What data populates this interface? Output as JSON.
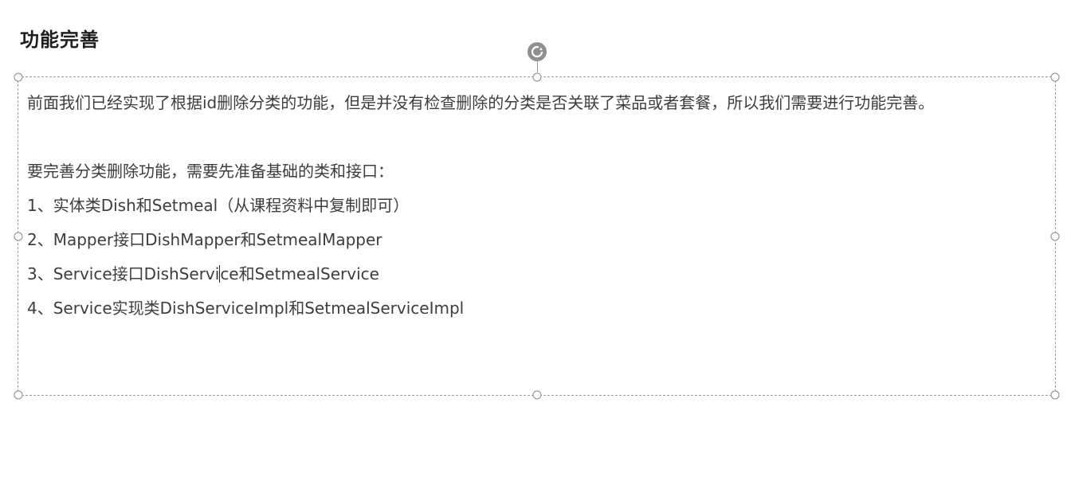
{
  "slide": {
    "title": "功能完善",
    "intro_paragraph": "前面我们已经实现了根据id删除分类的功能，但是并没有检查删除的分类是否关联了菜品或者套餐，所以我们需要进行功能完善。",
    "prep_line": "要完善分类删除功能，需要先准备基础的类和接口：",
    "items": [
      "1、实体类Dish和Setmeal（从课程资料中复制即可）",
      "2、Mapper接口DishMapper和SetmealMapper",
      "3、Service接口DishService和SetmealService",
      "4、Service实现类DishServiceImpl和SetmealServiceImpl"
    ],
    "item3_before_caret": "3、Service接口DishServi",
    "item3_after_caret": "ce和SetmealService"
  },
  "colors": {
    "title": "#1e1e1e",
    "body_text": "#3d3d3d",
    "selection_border": "#9a9a9a",
    "rotate_handle": "#8f8f8f"
  },
  "icons": {
    "rotate": "rotate-icon",
    "resize_handle": "resize-handle-circle"
  }
}
